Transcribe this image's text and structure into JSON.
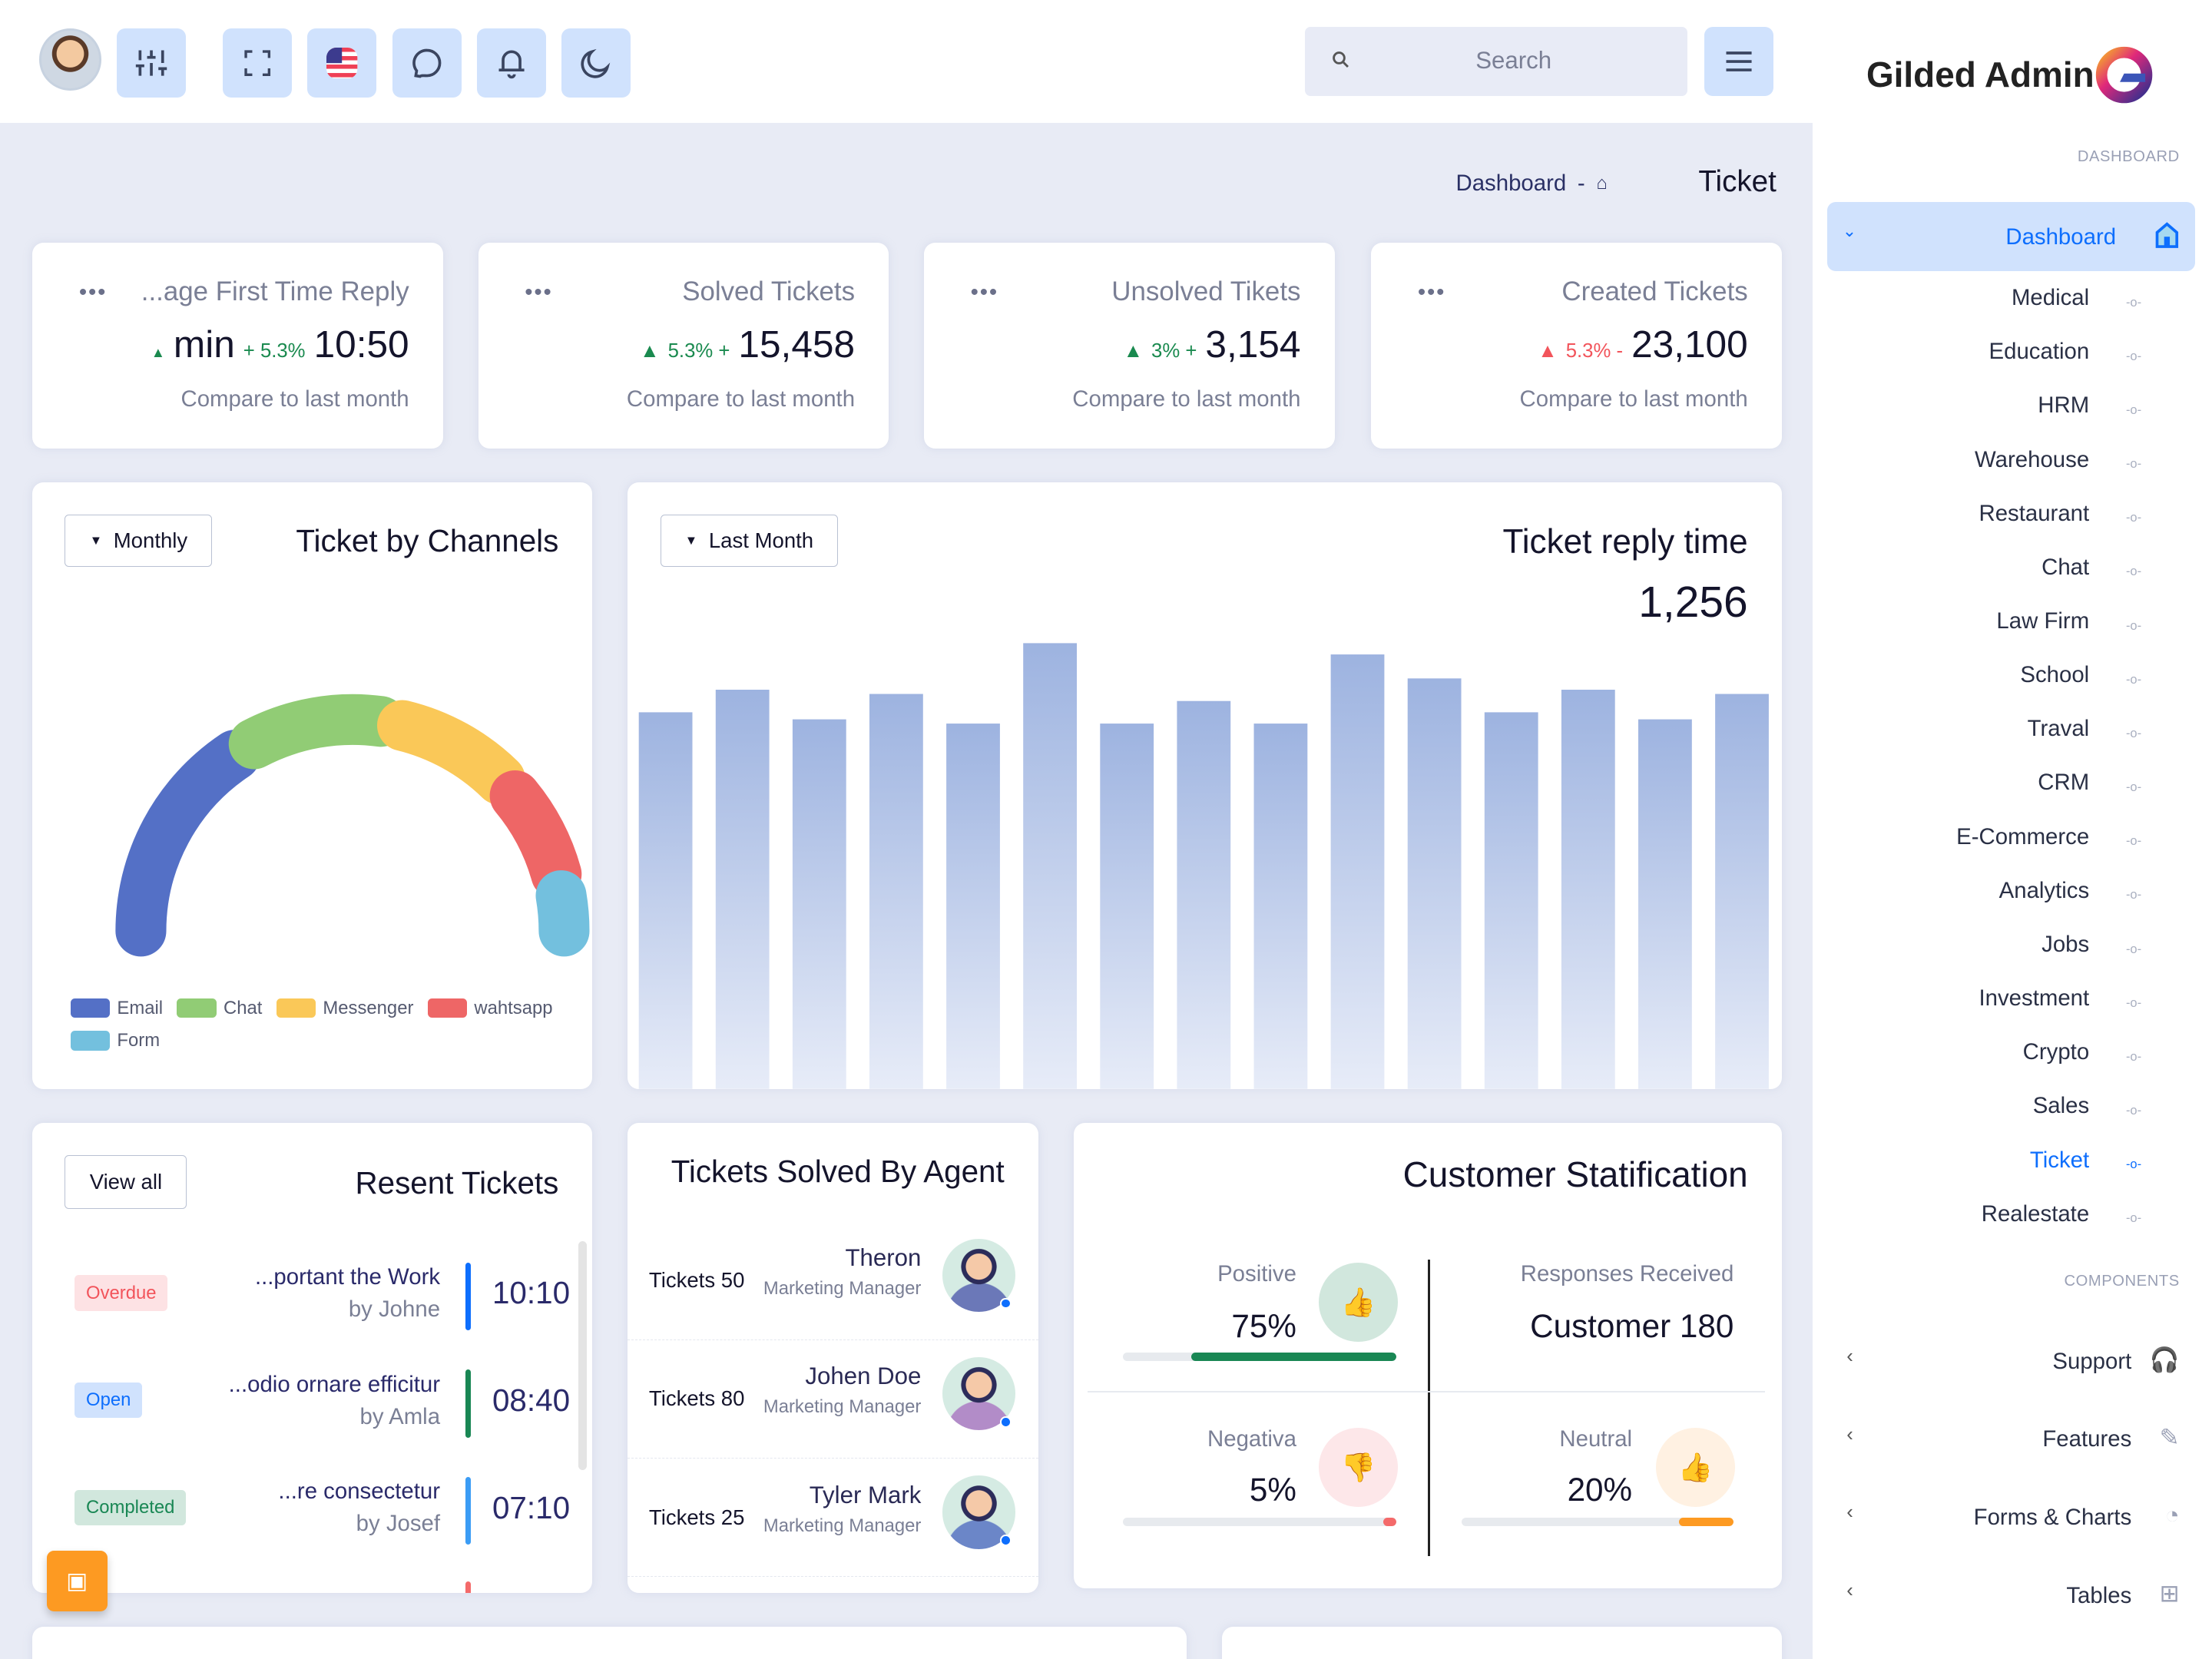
{
  "topbar": {
    "icons": [
      "avatar",
      "sliders-icon",
      "fullscreen-icon",
      "us-flag-icon",
      "chat-bubble-icon",
      "bell-icon",
      "moon-icon"
    ],
    "search_placeholder": "Search"
  },
  "breadcrumb": {
    "parent": "Dashboard",
    "separator": "-",
    "current": "Ticket"
  },
  "stats": [
    {
      "title": "...age First Time Reply",
      "unit": "min",
      "change": "+ 5.3%",
      "value": "10:50",
      "trend": "up",
      "compare": "Compare to last month"
    },
    {
      "title": "Solved Tickets",
      "change": "5.3% +",
      "value": "15,458",
      "trend": "up",
      "compare": "Compare to last month"
    },
    {
      "title": "Unsolved Tikets",
      "change": "3% +",
      "value": "3,154",
      "trend": "up",
      "compare": "Compare to last month"
    },
    {
      "title": "Created Tickets",
      "change": "5.3% -",
      "value": "23,100",
      "trend": "down",
      "compare": "Compare to last month"
    }
  ],
  "channels": {
    "title": "Ticket by Channels",
    "dropdown": "Monthly",
    "chart_data": {
      "type": "pie",
      "variant": "semi-donut",
      "categories": [
        "Email",
        "Chat",
        "Messenger",
        "wahtsapp",
        "Form"
      ],
      "values": [
        35,
        22,
        19,
        15,
        6
      ],
      "colors": [
        "#5470c6",
        "#91cc75",
        "#fac858",
        "#ee6666",
        "#73c0de"
      ],
      "legend": "bottom"
    }
  },
  "reply_time": {
    "title": "Ticket reply time",
    "value": "1,256",
    "dropdown": "Last Month",
    "chart_data": {
      "type": "bar",
      "values": [
        267,
        283,
        262,
        280,
        259,
        316,
        259,
        275,
        259,
        308,
        291,
        267,
        283,
        262,
        280
      ],
      "color": "#9db3e0",
      "grid": false,
      "axes": false
    }
  },
  "recent": {
    "title": "Resent Tickets",
    "view_all": "View all",
    "items": [
      {
        "status": "Overdue",
        "title": "...portant the Work",
        "by": "by Johne",
        "time": "10:10",
        "color": "#0d6efd"
      },
      {
        "status": "Open",
        "title": "...odio ornare efficitur",
        "by": "by Amla",
        "time": "08:40",
        "color": "#198754"
      },
      {
        "status": "Completed",
        "title": "...re consectetur",
        "by": "by Josef",
        "time": "07:10",
        "color": "#3b9cf5"
      }
    ]
  },
  "agents": {
    "title": "Tickets Solved By Agent",
    "items": [
      {
        "tickets": "Tickets 50",
        "name": "Theron",
        "role": "Marketing Manager"
      },
      {
        "tickets": "Tickets 80",
        "name": "Johen Doe",
        "role": "Marketing Manager"
      },
      {
        "tickets": "Tickets 25",
        "name": "Tyler Mark",
        "role": "Marketing Manager"
      }
    ]
  },
  "satisfaction": {
    "title": "Customer Statification",
    "positive": {
      "label": "Positive",
      "value": "75%",
      "fraction": 0.75,
      "color": "#198754"
    },
    "responses": {
      "label": "Responses Received",
      "value": "Customer 180"
    },
    "negative": {
      "label": "Negativa",
      "value": "5%",
      "fraction": 0.05,
      "color": "#f46a6a"
    },
    "neutral": {
      "label": "Neutral",
      "value": "20%",
      "fraction": 0.2,
      "color": "#fd9a22"
    }
  },
  "sidebar": {
    "logo": "Gilded Admin",
    "section1": "DASHBOARD",
    "active": "Dashboard",
    "items": [
      "Medical",
      "Education",
      "HRM",
      "Warehouse",
      "Restaurant",
      "Chat",
      "Law Firm",
      "School",
      "Traval",
      "CRM",
      "E-Commerce",
      "Analytics",
      "Jobs",
      "Investment",
      "Crypto",
      "Sales",
      "Ticket",
      "Realestate"
    ],
    "current": "Ticket",
    "section2": "COMPONENTS",
    "components": [
      {
        "label": "Support",
        "icon": "headphones-icon"
      },
      {
        "label": "Features",
        "icon": "edit-icon"
      },
      {
        "label": "Forms & Charts",
        "icon": "pie-chart-icon"
      },
      {
        "label": "Tables",
        "icon": "grid-icon"
      }
    ]
  },
  "colors": {
    "accent": "#0d6efd",
    "icon_bg": "#d0e2fd",
    "page_bg": "#e8ebf5"
  }
}
